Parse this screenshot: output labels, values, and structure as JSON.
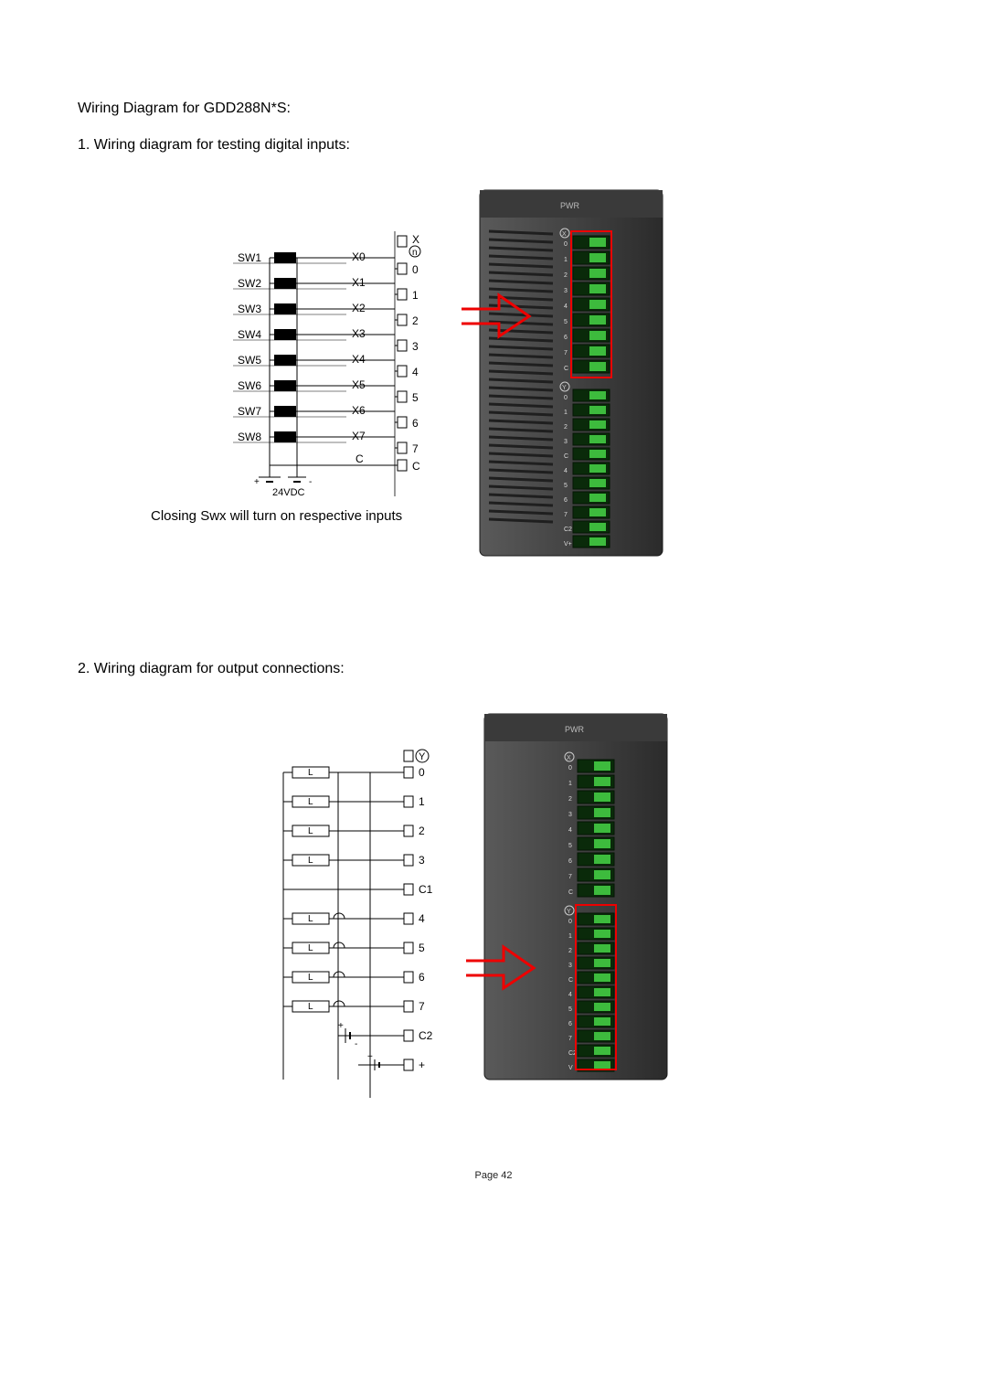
{
  "heading": "Wiring Diagram for GDD288N*S:",
  "sec1": {
    "title": "1. Wiring diagram for testing digital inputs:",
    "caption": "Closing Swx will turn on respective inputs",
    "rows": [
      {
        "sw": "SW1",
        "x": "X0",
        "t": "0"
      },
      {
        "sw": "SW2",
        "x": "X1",
        "t": "1"
      },
      {
        "sw": "SW3",
        "x": "X2",
        "t": "2"
      },
      {
        "sw": "SW4",
        "x": "X3",
        "t": "3"
      },
      {
        "sw": "SW5",
        "x": "X4",
        "t": "4"
      },
      {
        "sw": "SW6",
        "x": "X5",
        "t": "5"
      },
      {
        "sw": "SW7",
        "x": "X6",
        "t": "6"
      },
      {
        "sw": "SW8",
        "x": "X7",
        "t": "7"
      }
    ],
    "cRow": {
      "x": "C",
      "t": "C"
    },
    "topLabel": "X",
    "circle": "n",
    "supply": "24VDC",
    "plus": "+",
    "minus": "-",
    "moduleLabel": "PWR",
    "xMark": "X",
    "yMark": "Y",
    "termsUpper": [
      "0",
      "1",
      "2",
      "3",
      "4",
      "5",
      "6",
      "7",
      "C"
    ],
    "termsLower": [
      "0",
      "1",
      "2",
      "3",
      "C",
      "4",
      "5",
      "6",
      "7",
      "C2",
      "V+"
    ]
  },
  "sec2": {
    "title": "2. Wiring diagram for output connections:",
    "rows": [
      {
        "t": "0"
      },
      {
        "t": "1"
      },
      {
        "t": "2"
      },
      {
        "t": "3"
      },
      {
        "t": "C1"
      },
      {
        "t": "4"
      },
      {
        "t": "5"
      },
      {
        "t": "6"
      },
      {
        "t": "7"
      },
      {
        "t": "C2"
      },
      {
        "t": "+"
      }
    ],
    "topLabel": "Y",
    "loadLabel": "L",
    "plus": "+",
    "minus": "-",
    "moduleLabel": "PWR",
    "xMark": "X",
    "yMark": "Y",
    "termsUpper": [
      "0",
      "1",
      "2",
      "3",
      "4",
      "5",
      "6",
      "7",
      "C"
    ],
    "termsLower": [
      "0",
      "1",
      "2",
      "3",
      "C",
      "4",
      "5",
      "6",
      "7",
      "C2",
      "V"
    ]
  },
  "pagefoot": "Page 42"
}
